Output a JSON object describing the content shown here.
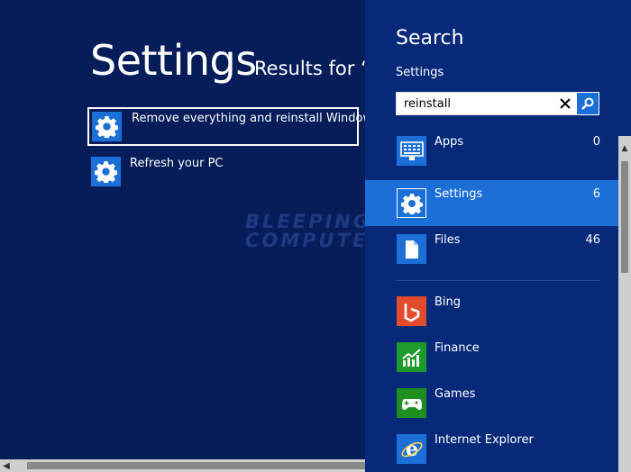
{
  "results": {
    "title": "Settings",
    "subtitle": "Results for “r",
    "items": [
      {
        "label": "Remove everything and reinstall Windows",
        "icon": "gear-icon"
      },
      {
        "label": "Refresh your PC",
        "icon": "gear-icon"
      }
    ]
  },
  "watermark": {
    "line1": "BLEEPING",
    "line2": "COMPUTER"
  },
  "search_panel": {
    "title": "Search",
    "scope": "Settings",
    "query": "reinstall",
    "categories": [
      {
        "label": "Apps",
        "count": "0",
        "icon": "apps-icon"
      },
      {
        "label": "Settings",
        "count": "6",
        "icon": "gear-icon"
      },
      {
        "label": "Files",
        "count": "46",
        "icon": "file-icon"
      }
    ],
    "apps": [
      {
        "label": "Bing",
        "icon": "bing-icon"
      },
      {
        "label": "Finance",
        "icon": "finance-icon"
      },
      {
        "label": "Games",
        "icon": "games-icon"
      },
      {
        "label": "Internet Explorer",
        "icon": "ie-icon"
      }
    ]
  },
  "colors": {
    "results_bg": "#061d5a",
    "panel_bg": "#07297a",
    "accent": "#1b6fd6",
    "bing": "#e34b2c",
    "finance": "#1d9a2a",
    "games": "#1f8f1f",
    "ie": "#1b6fd6"
  }
}
